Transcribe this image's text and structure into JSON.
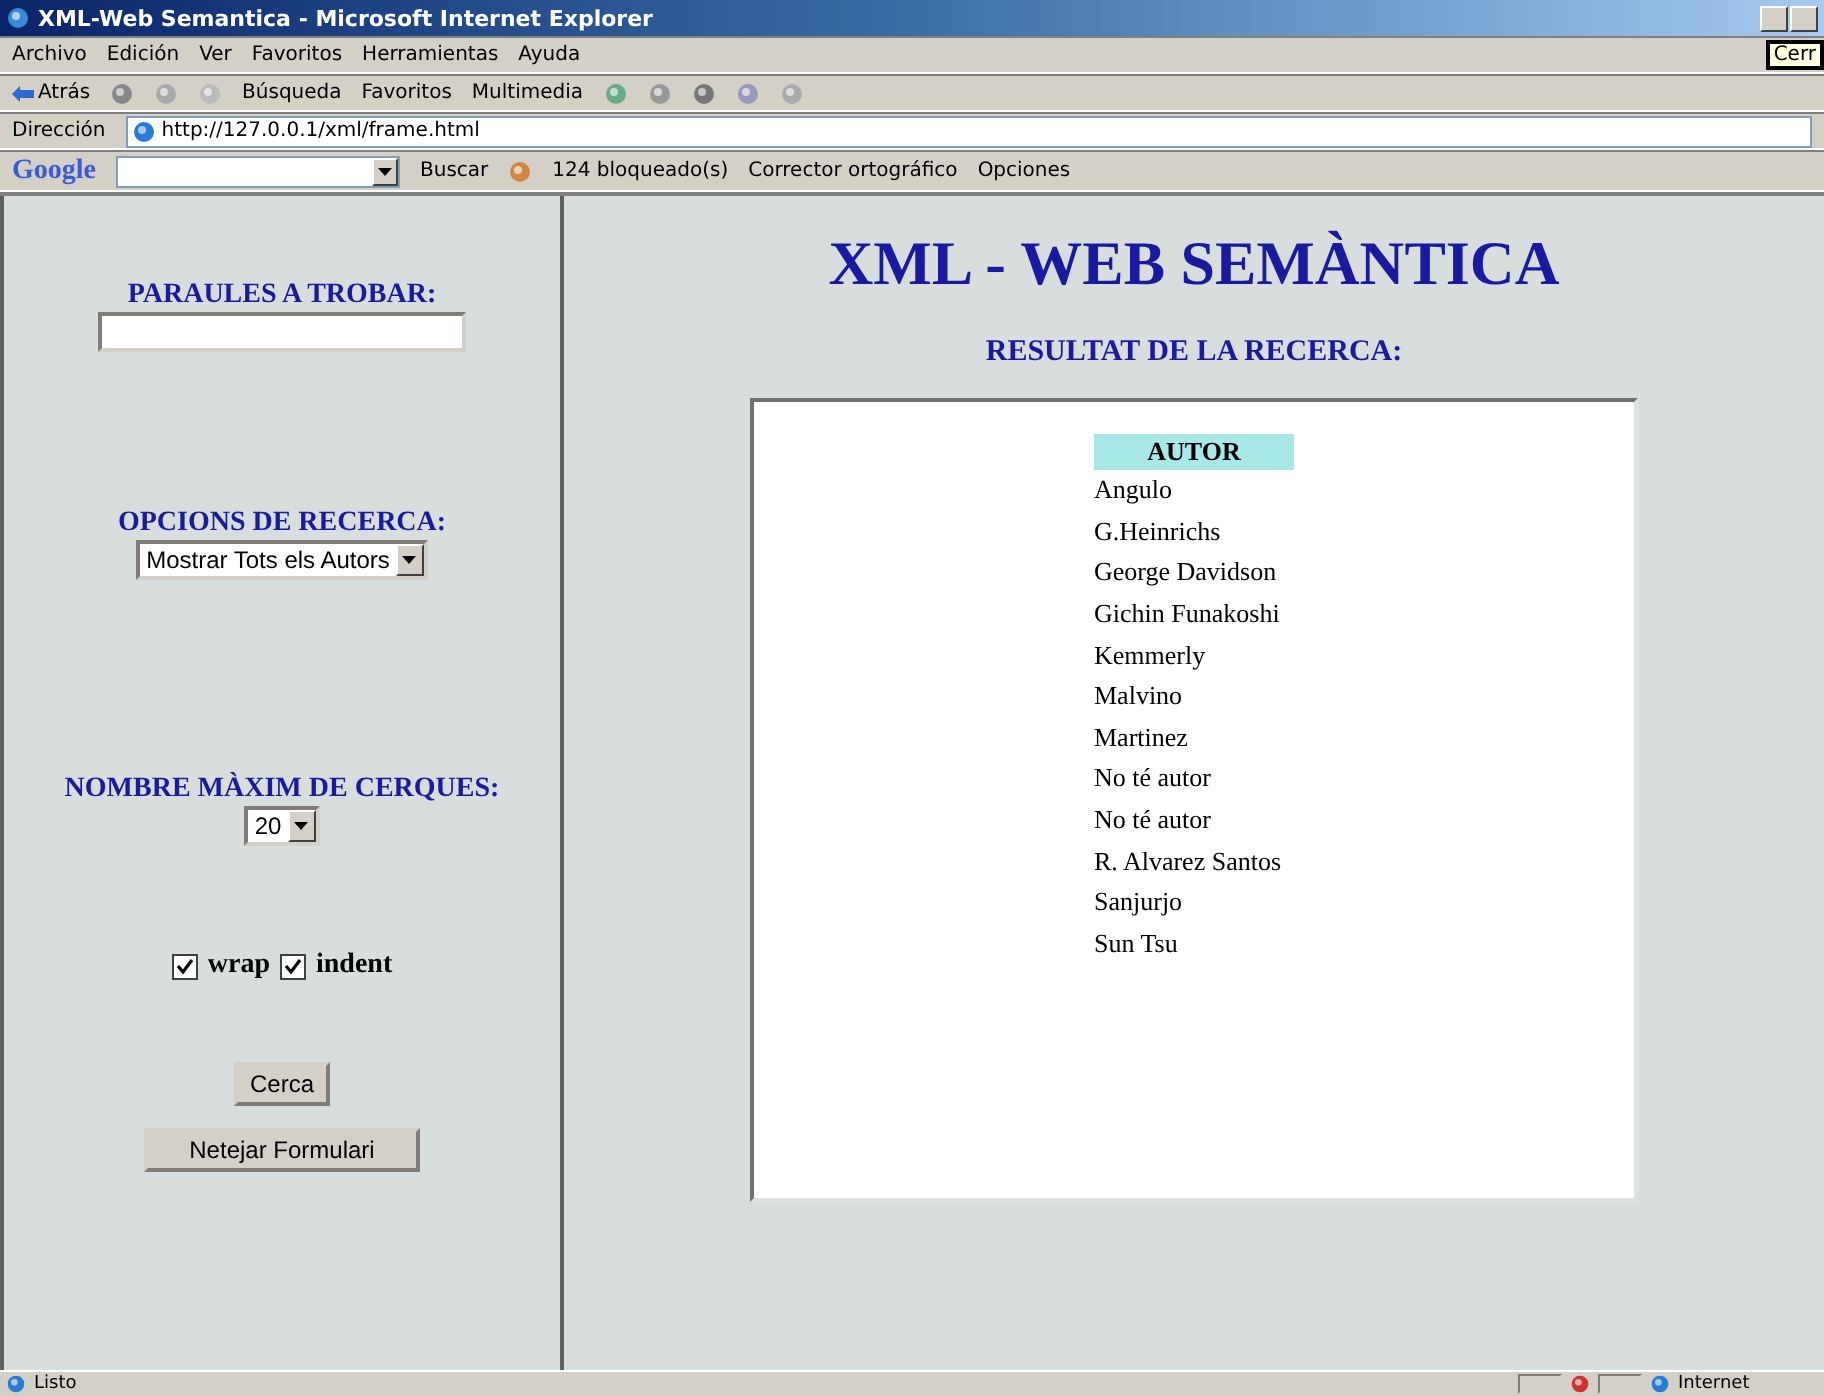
{
  "window": {
    "title": "XML-Web Semantica - Microsoft Internet Explorer",
    "tooltip": "Cerr"
  },
  "menu": [
    "Archivo",
    "Edición",
    "Ver",
    "Favoritos",
    "Herramientas",
    "Ayuda"
  ],
  "toolbar": {
    "back": "Atrás",
    "search": "Búsqueda",
    "favorites": "Favoritos",
    "media": "Multimedia"
  },
  "address": {
    "label": "Dirección",
    "url": "http://127.0.0.1/xml/frame.html"
  },
  "google_bar": {
    "logo": "Google",
    "search": "Buscar",
    "blocked": "124 bloqueado(s)",
    "spell": "Corrector ortográfico",
    "options": "Opciones"
  },
  "form": {
    "words_label": "PARAULES A TROBAR:",
    "options_label": "OPCIONS DE RECERCA:",
    "options_value": "Mostrar Tots els Autors",
    "max_label": "NOMBRE MÀXIM DE CERQUES:",
    "max_value": "20",
    "checkboxes": [
      {
        "label": "wrap",
        "checked": true
      },
      {
        "label": "indent",
        "checked": true
      }
    ],
    "buttons": [
      "Cerca",
      "Netejar Formulari"
    ]
  },
  "results": {
    "title": "XML - WEB SEMÀNTICA",
    "subtitle": "RESULTAT DE LA RECERCA:",
    "column": "AUTOR",
    "rows": [
      "Angulo",
      "G.Heinrichs",
      "George Davidson",
      "Gichin Funakoshi",
      "Kemmerly",
      "Malvino",
      "Martinez",
      "No té autor",
      "No té autor",
      "R. Alvarez Santos",
      "Sanjurjo",
      "Sun Tsu"
    ]
  },
  "status_bar": {
    "text": "Listo",
    "zone": "Internet"
  }
}
